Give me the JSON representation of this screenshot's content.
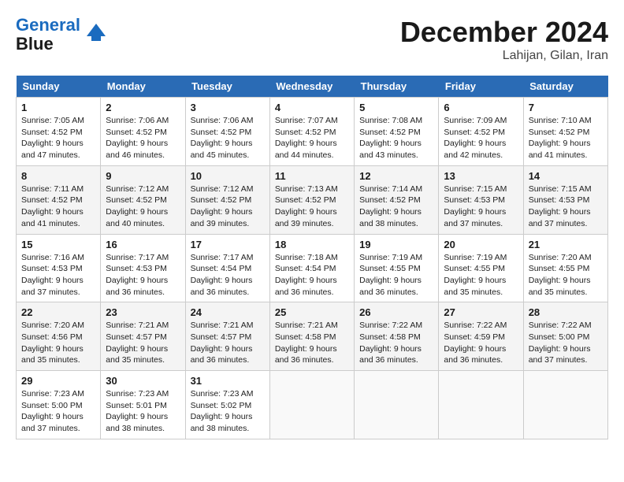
{
  "header": {
    "logo_line1": "General",
    "logo_line2": "Blue",
    "month": "December 2024",
    "location": "Lahijan, Gilan, Iran"
  },
  "days_of_week": [
    "Sunday",
    "Monday",
    "Tuesday",
    "Wednesday",
    "Thursday",
    "Friday",
    "Saturday"
  ],
  "weeks": [
    [
      {
        "day": "1",
        "sunrise": "7:05 AM",
        "sunset": "4:52 PM",
        "daylight": "9 hours and 47 minutes."
      },
      {
        "day": "2",
        "sunrise": "7:06 AM",
        "sunset": "4:52 PM",
        "daylight": "9 hours and 46 minutes."
      },
      {
        "day": "3",
        "sunrise": "7:06 AM",
        "sunset": "4:52 PM",
        "daylight": "9 hours and 45 minutes."
      },
      {
        "day": "4",
        "sunrise": "7:07 AM",
        "sunset": "4:52 PM",
        "daylight": "9 hours and 44 minutes."
      },
      {
        "day": "5",
        "sunrise": "7:08 AM",
        "sunset": "4:52 PM",
        "daylight": "9 hours and 43 minutes."
      },
      {
        "day": "6",
        "sunrise": "7:09 AM",
        "sunset": "4:52 PM",
        "daylight": "9 hours and 42 minutes."
      },
      {
        "day": "7",
        "sunrise": "7:10 AM",
        "sunset": "4:52 PM",
        "daylight": "9 hours and 41 minutes."
      }
    ],
    [
      {
        "day": "8",
        "sunrise": "7:11 AM",
        "sunset": "4:52 PM",
        "daylight": "9 hours and 41 minutes."
      },
      {
        "day": "9",
        "sunrise": "7:12 AM",
        "sunset": "4:52 PM",
        "daylight": "9 hours and 40 minutes."
      },
      {
        "day": "10",
        "sunrise": "7:12 AM",
        "sunset": "4:52 PM",
        "daylight": "9 hours and 39 minutes."
      },
      {
        "day": "11",
        "sunrise": "7:13 AM",
        "sunset": "4:52 PM",
        "daylight": "9 hours and 39 minutes."
      },
      {
        "day": "12",
        "sunrise": "7:14 AM",
        "sunset": "4:52 PM",
        "daylight": "9 hours and 38 minutes."
      },
      {
        "day": "13",
        "sunrise": "7:15 AM",
        "sunset": "4:53 PM",
        "daylight": "9 hours and 37 minutes."
      },
      {
        "day": "14",
        "sunrise": "7:15 AM",
        "sunset": "4:53 PM",
        "daylight": "9 hours and 37 minutes."
      }
    ],
    [
      {
        "day": "15",
        "sunrise": "7:16 AM",
        "sunset": "4:53 PM",
        "daylight": "9 hours and 37 minutes."
      },
      {
        "day": "16",
        "sunrise": "7:17 AM",
        "sunset": "4:53 PM",
        "daylight": "9 hours and 36 minutes."
      },
      {
        "day": "17",
        "sunrise": "7:17 AM",
        "sunset": "4:54 PM",
        "daylight": "9 hours and 36 minutes."
      },
      {
        "day": "18",
        "sunrise": "7:18 AM",
        "sunset": "4:54 PM",
        "daylight": "9 hours and 36 minutes."
      },
      {
        "day": "19",
        "sunrise": "7:19 AM",
        "sunset": "4:55 PM",
        "daylight": "9 hours and 36 minutes."
      },
      {
        "day": "20",
        "sunrise": "7:19 AM",
        "sunset": "4:55 PM",
        "daylight": "9 hours and 35 minutes."
      },
      {
        "day": "21",
        "sunrise": "7:20 AM",
        "sunset": "4:55 PM",
        "daylight": "9 hours and 35 minutes."
      }
    ],
    [
      {
        "day": "22",
        "sunrise": "7:20 AM",
        "sunset": "4:56 PM",
        "daylight": "9 hours and 35 minutes."
      },
      {
        "day": "23",
        "sunrise": "7:21 AM",
        "sunset": "4:57 PM",
        "daylight": "9 hours and 35 minutes."
      },
      {
        "day": "24",
        "sunrise": "7:21 AM",
        "sunset": "4:57 PM",
        "daylight": "9 hours and 36 minutes."
      },
      {
        "day": "25",
        "sunrise": "7:21 AM",
        "sunset": "4:58 PM",
        "daylight": "9 hours and 36 minutes."
      },
      {
        "day": "26",
        "sunrise": "7:22 AM",
        "sunset": "4:58 PM",
        "daylight": "9 hours and 36 minutes."
      },
      {
        "day": "27",
        "sunrise": "7:22 AM",
        "sunset": "4:59 PM",
        "daylight": "9 hours and 36 minutes."
      },
      {
        "day": "28",
        "sunrise": "7:22 AM",
        "sunset": "5:00 PM",
        "daylight": "9 hours and 37 minutes."
      }
    ],
    [
      {
        "day": "29",
        "sunrise": "7:23 AM",
        "sunset": "5:00 PM",
        "daylight": "9 hours and 37 minutes."
      },
      {
        "day": "30",
        "sunrise": "7:23 AM",
        "sunset": "5:01 PM",
        "daylight": "9 hours and 38 minutes."
      },
      {
        "day": "31",
        "sunrise": "7:23 AM",
        "sunset": "5:02 PM",
        "daylight": "9 hours and 38 minutes."
      },
      null,
      null,
      null,
      null
    ]
  ]
}
